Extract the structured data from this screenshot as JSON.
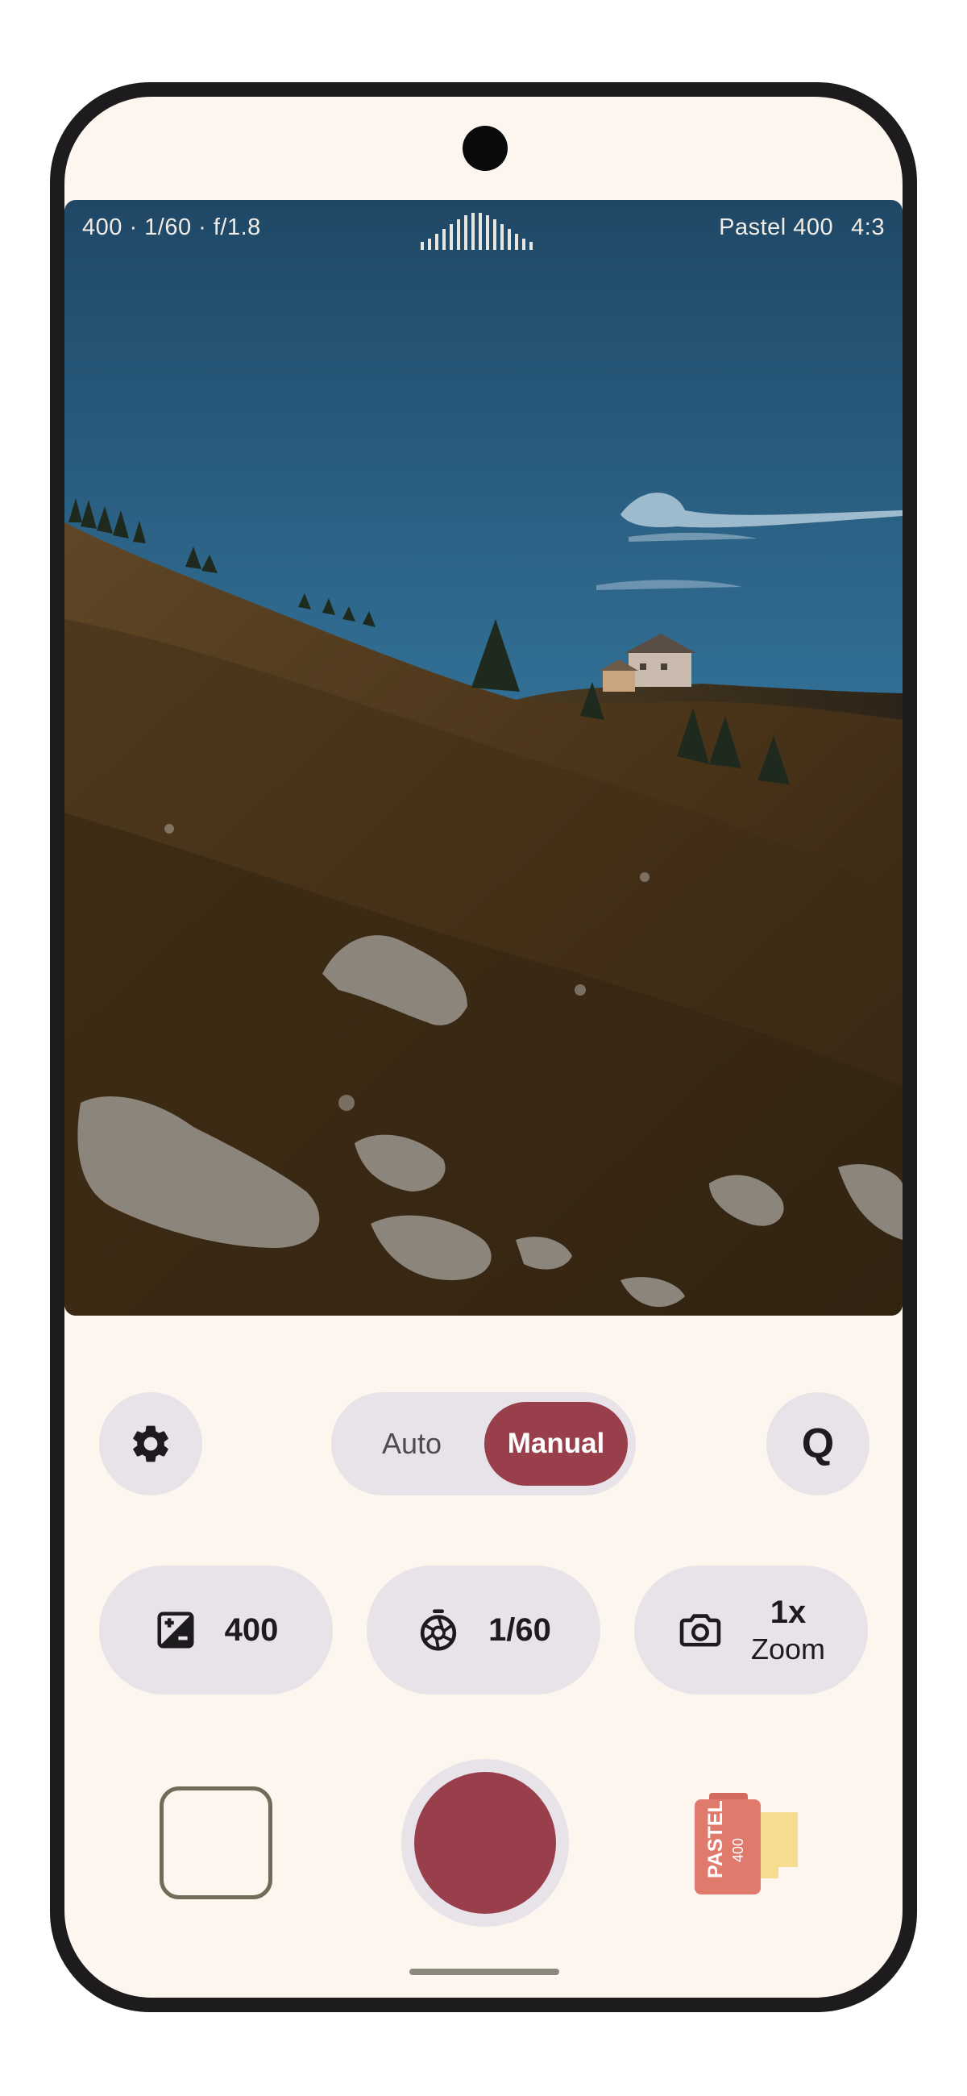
{
  "hud": {
    "exposure": "400 · 1/60 · f/1.8",
    "film_name": "Pastel 400",
    "aspect_ratio": "4:3"
  },
  "mode_toggle": {
    "auto_label": "Auto",
    "manual_label": "Manual",
    "selected": "Manual"
  },
  "quick_button": {
    "label": "Q"
  },
  "controls": {
    "iso": {
      "icon": "exposure-icon",
      "value": "400"
    },
    "shutter": {
      "icon": "shutter-speed-icon",
      "value": "1/60"
    },
    "zoom": {
      "icon": "camera-icon",
      "value": "1x",
      "label": "Zoom"
    }
  },
  "film": {
    "brand": "PASTEL",
    "speed": "400"
  },
  "colors": {
    "accent": "#993f4c",
    "surface": "#fdf6ee",
    "chip": "#e8e3e8",
    "frame": "#1d1b1e",
    "film_canister": "#df7a6c",
    "film_strip": "#f6dc8f"
  }
}
